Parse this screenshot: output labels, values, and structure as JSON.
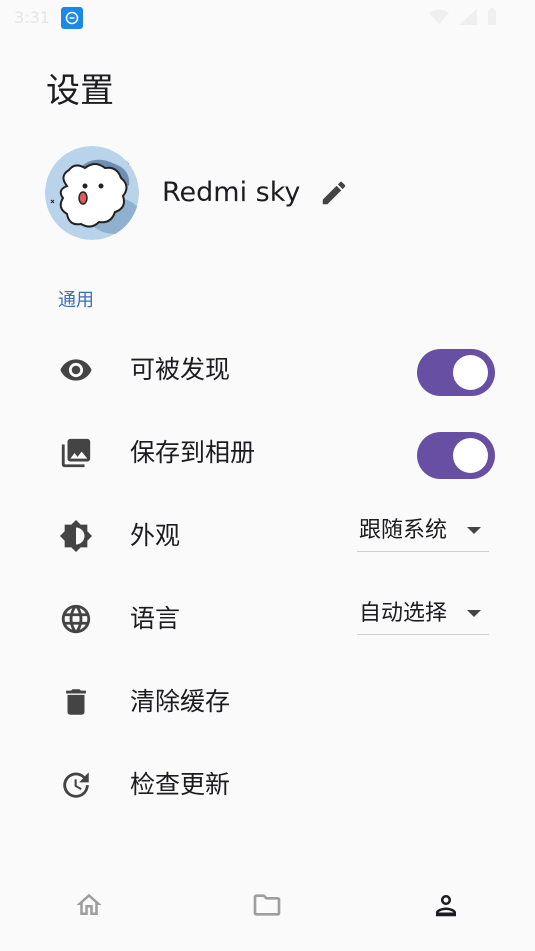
{
  "status_bar": {
    "time": "3:31",
    "app_icon": "link-icon",
    "indicators": [
      "wifi-icon",
      "signal-icon",
      "battery-icon"
    ]
  },
  "page": {
    "title": "设置"
  },
  "profile": {
    "name": "Redmi sky",
    "avatar": "avatar-cartoon",
    "edit_icon": "pencil-icon"
  },
  "sections": {
    "general": "通用",
    "second": ""
  },
  "settings": {
    "discoverable": {
      "label": "可被发现",
      "icon": "eye-icon",
      "enabled": true
    },
    "save_to_album": {
      "label": "保存到相册",
      "icon": "photo-library-icon",
      "enabled": true
    },
    "appearance": {
      "label": "外观",
      "icon": "brightness-icon",
      "value": "跟随系统"
    },
    "language": {
      "label": "语言",
      "icon": "globe-icon",
      "value": "自动选择"
    },
    "clear_cache": {
      "label": "清除缓存",
      "icon": "trash-icon"
    },
    "check_update": {
      "label": "检查更新",
      "icon": "update-clock-icon"
    }
  },
  "bottom_nav": {
    "items": [
      {
        "name": "home",
        "icon": "home-icon",
        "active": false
      },
      {
        "name": "files",
        "icon": "folder-icon",
        "active": false
      },
      {
        "name": "profile",
        "icon": "person-icon",
        "active": true
      }
    ]
  },
  "colors": {
    "accent": "#6750a4",
    "section_header": "#3b6fb6",
    "background": "#fafafa",
    "text": "#1c1b1f"
  }
}
